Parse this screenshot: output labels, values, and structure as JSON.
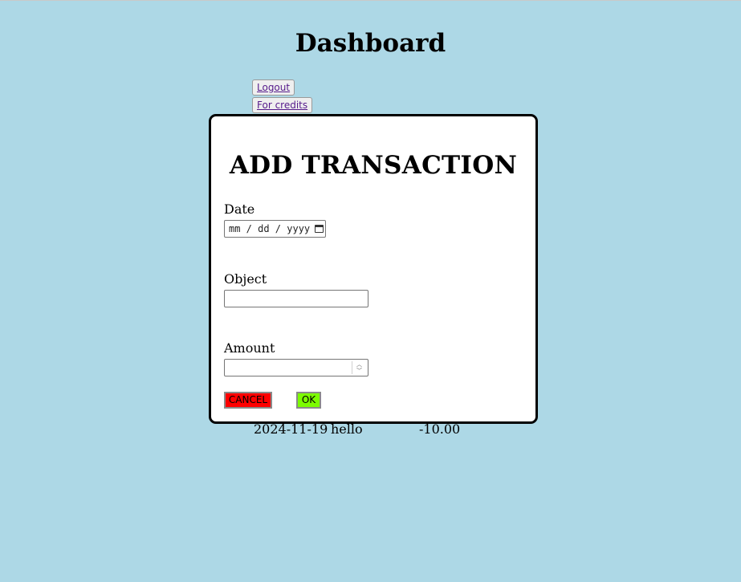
{
  "page": {
    "title": "Dashboard"
  },
  "nav": {
    "logout_label": "Logout",
    "credits_label": "For credits"
  },
  "transactions": [
    {
      "date": "2024-11-19",
      "object": "hello",
      "amount": "-10.00"
    }
  ],
  "modal": {
    "title": "ADD TRANSACTION",
    "date_label": "Date",
    "date_placeholder": "mm / dd / yyyy",
    "object_label": "Object",
    "object_value": "",
    "amount_label": "Amount",
    "amount_value": "",
    "cancel_label": "CANCEL",
    "ok_label": "OK"
  },
  "colors": {
    "background": "#add8e6",
    "cancel": "#ff0000",
    "ok": "#7cfc00"
  }
}
